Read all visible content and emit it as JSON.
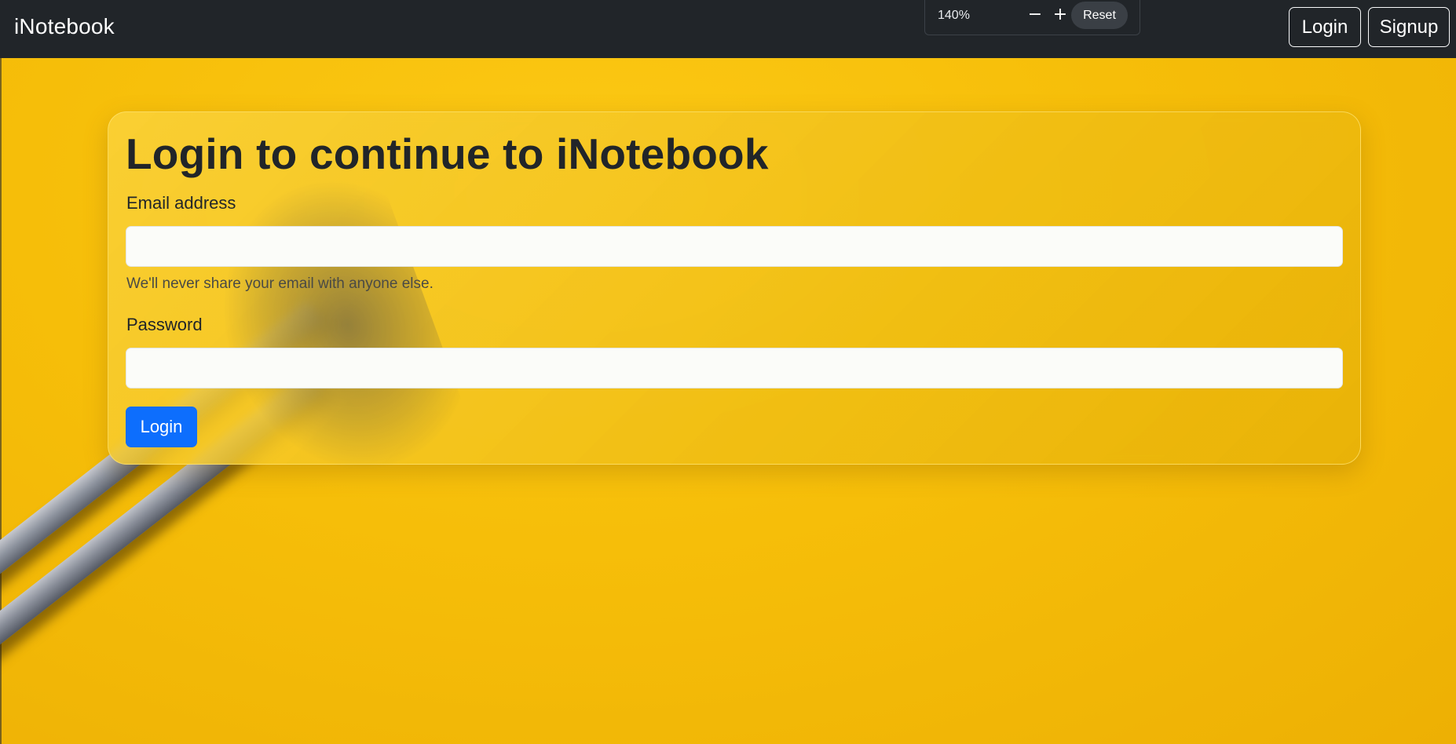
{
  "navbar": {
    "brand": "iNotebook",
    "login_label": "Login",
    "signup_label": "Signup",
    "bg_color": "#212529"
  },
  "zoom": {
    "level": "140%",
    "minus_label": "−",
    "plus_label": "+",
    "reset_label": "Reset"
  },
  "form": {
    "title": "Login to continue to iNotebook",
    "email_label": "Email address",
    "email_value": "",
    "email_help": "We'll never share your email with anyone else.",
    "password_label": "Password",
    "password_value": "",
    "submit_label": "Login",
    "submit_color": "#0d6efd"
  },
  "background": {
    "accent": "#f6be09"
  }
}
